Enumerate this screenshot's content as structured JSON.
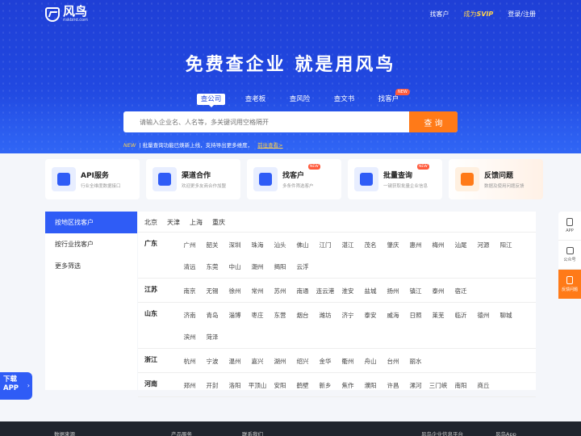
{
  "header": {
    "logo_name": "风鸟",
    "logo_url": "riskbird.com",
    "nav": {
      "find_customers": "找客户",
      "vip_prefix": "成为",
      "vip": "SVIP",
      "login": "登录/注册"
    }
  },
  "hero": {
    "headline": "免费查企业 就是用风鸟",
    "tabs": [
      {
        "label": "查公司",
        "active": true
      },
      {
        "label": "查老板"
      },
      {
        "label": "查风险"
      },
      {
        "label": "查文书"
      },
      {
        "label": "找客户",
        "badge": "NEW"
      }
    ],
    "search_placeholder": "请输入企业名、人名等，多关键词用空格隔开",
    "search_button": "查 询",
    "notice_new": "NEW",
    "notice_text": "| 批量查询功能已焕新上线，支持导出更多维度，",
    "notice_link": "前往查看>"
  },
  "features": [
    {
      "title": "API服务",
      "desc": "行业全维度数据接口",
      "icon": "api-icon"
    },
    {
      "title": "渠道合作",
      "desc": "欢迎更多友商合作加盟",
      "icon": "handshake-icon"
    },
    {
      "title": "找客户",
      "desc": "多条件筛选客户",
      "icon": "search-doc-icon",
      "badge": "NEW"
    },
    {
      "title": "批量查询",
      "desc": "一键获取批量企业信息",
      "icon": "batch-icon",
      "badge": "NEW"
    },
    {
      "title": "反馈问题",
      "desc": "数据及使用问题反馈",
      "icon": "feedback-icon"
    }
  ],
  "sidenav": [
    "按地区找客户",
    "按行业找客户",
    "更多筛选"
  ],
  "top_cities": [
    "北京",
    "天津",
    "上海",
    "重庆"
  ],
  "provinces": [
    {
      "name": "广东",
      "cities": [
        "广州",
        "韶关",
        "深圳",
        "珠海",
        "汕头",
        "佛山",
        "江门",
        "湛江",
        "茂名",
        "肇庆",
        "惠州",
        "梅州",
        "汕尾",
        "河源",
        "阳江",
        "清远",
        "东莞",
        "中山",
        "潮州",
        "揭阳",
        "云浮"
      ]
    },
    {
      "name": "江苏",
      "cities": [
        "南京",
        "无锡",
        "徐州",
        "常州",
        "苏州",
        "南通",
        "连云港",
        "淮安",
        "盐城",
        "扬州",
        "镇江",
        "泰州",
        "宿迁"
      ]
    },
    {
      "name": "山东",
      "cities": [
        "济南",
        "青岛",
        "淄博",
        "枣庄",
        "东营",
        "烟台",
        "潍坊",
        "济宁",
        "泰安",
        "威海",
        "日照",
        "莱芜",
        "临沂",
        "德州",
        "聊城",
        "滨州",
        "菏泽"
      ]
    },
    {
      "name": "浙江",
      "cities": [
        "杭州",
        "宁波",
        "温州",
        "嘉兴",
        "湖州",
        "绍兴",
        "金华",
        "衢州",
        "舟山",
        "台州",
        "丽水"
      ]
    },
    {
      "name": "河南",
      "cities": [
        "郑州",
        "开封",
        "洛阳",
        "平顶山",
        "安阳",
        "鹤壁",
        "新乡",
        "焦作",
        "濮阳",
        "许昌",
        "漯河",
        "三门峡",
        "南阳",
        "商丘"
      ]
    }
  ],
  "rail": [
    "APP",
    "公众号",
    "反馈问题"
  ],
  "download_app": {
    "line1": "下载",
    "line2": "APP",
    "arrow": "›"
  },
  "footer": [
    "数据来源",
    "产品服务",
    "联系我们",
    "风鸟企业信息平台",
    "风鸟App"
  ]
}
